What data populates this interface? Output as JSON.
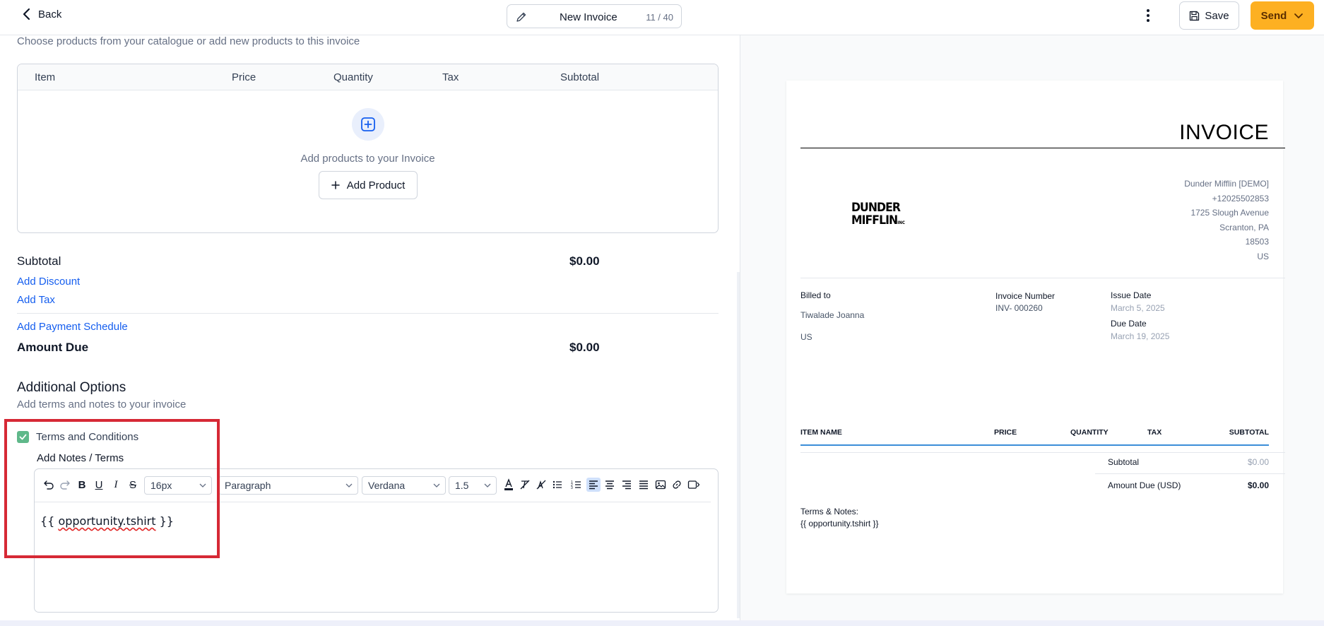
{
  "topbar": {
    "back_label": "Back",
    "doc_title": "New Invoice",
    "char_count": "11 / 40",
    "save_label": "Save",
    "send_label": "Send"
  },
  "products": {
    "subtitle": "Choose products from your catalogue or add new products to this invoice",
    "columns": [
      "Item",
      "Price",
      "Quantity",
      "Tax",
      "Subtotal"
    ],
    "empty_text": "Add products to your Invoice",
    "add_product_label": "Add Product"
  },
  "totals": {
    "subtotal_label": "Subtotal",
    "subtotal_value": "$0.00",
    "add_discount": "Add Discount",
    "add_tax": "Add Tax",
    "add_payment_schedule": "Add Payment Schedule",
    "amount_due_label": "Amount Due",
    "amount_due_value": "$0.00"
  },
  "options": {
    "title": "Additional Options",
    "subtitle": "Add terms and notes to your invoice",
    "terms_label": "Terms and Conditions",
    "terms_checked": true,
    "notes_label": "Add Notes / Terms"
  },
  "editor": {
    "font_size": "16px",
    "block_format": "Paragraph",
    "font_family": "Verdana",
    "line_height": "1.5",
    "content_prefix": "{{ ",
    "content_var": "opportunity.tshirt",
    "content_suffix": " }}",
    "active_align": "align-left"
  },
  "preview": {
    "heading": "INVOICE",
    "logo_line1": "DUNDER",
    "logo_line2": "MIFFLIN",
    "logo_small": "INC",
    "company": {
      "name": "Dunder Mifflin [DEMO]",
      "phone": "+12025502853",
      "street": "1725 Slough Avenue",
      "city": "Scranton, PA",
      "zip": "18503",
      "country": "US"
    },
    "billed_to_label": "Billed to",
    "billed_name": "Tiwalade Joanna",
    "billed_country": "US",
    "invoice_number_label": "Invoice Number",
    "invoice_number": "INV- 000260",
    "issue_date_label": "Issue Date",
    "issue_date": "March 5, 2025",
    "due_date_label": "Due Date",
    "due_date": "March 19, 2025",
    "table_columns": [
      "ITEM NAME",
      "PRICE",
      "QUANTITY",
      "TAX",
      "SUBTOTAL"
    ],
    "subtotal_label": "Subtotal",
    "subtotal_value": "$0.00",
    "amount_due_label": "Amount Due (USD)",
    "amount_due_value": "$0.00",
    "terms_label": "Terms & Notes:",
    "terms_value": "{{ opportunity.tshirt }}"
  },
  "colors": {
    "accent_send": "#fdb022",
    "link": "#155eef",
    "checkbox": "#5fb88a",
    "highlight": "#d62935"
  }
}
